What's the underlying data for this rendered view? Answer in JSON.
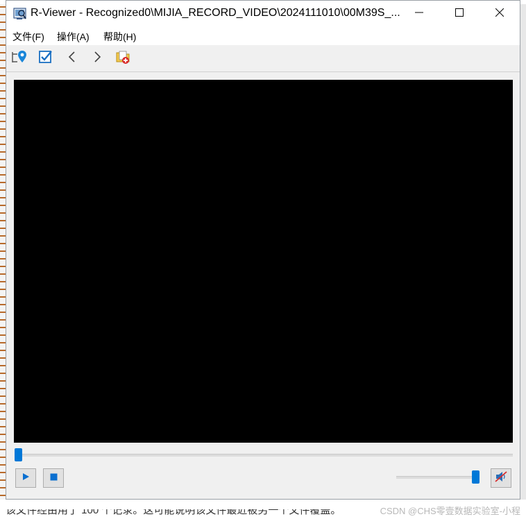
{
  "background": {
    "bottom_text": "该文件经由用了 100 个记录。这可能说明该文件最近被另一个文件覆盖。",
    "watermark": "CSDN @CHS零壹数据实验室-小程"
  },
  "window": {
    "title": "R-Viewer - Recognized0\\MIJIA_RECORD_VIDEO\\2024111010\\00M39S_...",
    "controls": {
      "minimize_icon": "minimize-icon",
      "maximize_icon": "maximize-icon",
      "close_icon": "close-icon"
    }
  },
  "menu": {
    "items": [
      {
        "label": "文件(F)"
      },
      {
        "label": "操作(A)"
      },
      {
        "label": "帮助(H)"
      }
    ]
  },
  "toolbar": {
    "icons": [
      "locate-icon",
      "checkbox-icon",
      "chevron-left-icon",
      "chevron-right-icon",
      "recover-folder-icon"
    ]
  },
  "player": {
    "seek_position_fraction": 0.0,
    "volume_fraction": 1.0,
    "muted": true,
    "accent_color": "#0078d7",
    "video_background": "#000000"
  }
}
